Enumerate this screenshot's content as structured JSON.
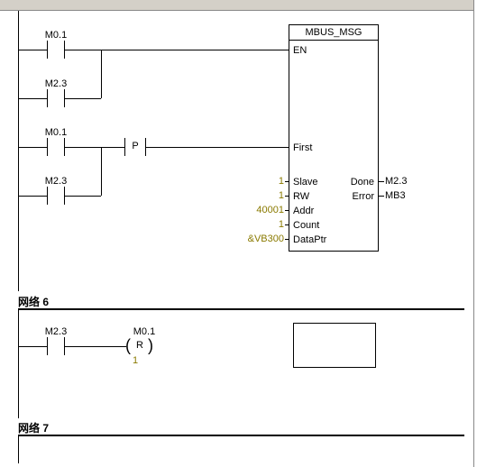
{
  "network5": {
    "block_title": "MBUS_MSG",
    "contacts": {
      "c1": "M0.1",
      "c2": "M2.3",
      "c3": "M0.1",
      "c4": "M2.3"
    },
    "p_label": "P",
    "ports_left": {
      "en": "EN",
      "first": "First",
      "slave": "Slave",
      "rw": "RW",
      "addr": "Addr",
      "count": "Count",
      "dataptr": "DataPtr"
    },
    "ports_right": {
      "done": "Done",
      "error": "Error"
    },
    "inputs": {
      "slave": "1",
      "rw": "1",
      "addr": "40001",
      "count": "1",
      "dataptr": "&VB300"
    },
    "outputs": {
      "done": "M2.3",
      "error": "MB3"
    }
  },
  "network6": {
    "title": "网络 6",
    "contact": "M2.3",
    "coil_label": "M0.1",
    "coil_type": "R",
    "coil_value": "1"
  },
  "network7": {
    "title": "网络 7"
  }
}
